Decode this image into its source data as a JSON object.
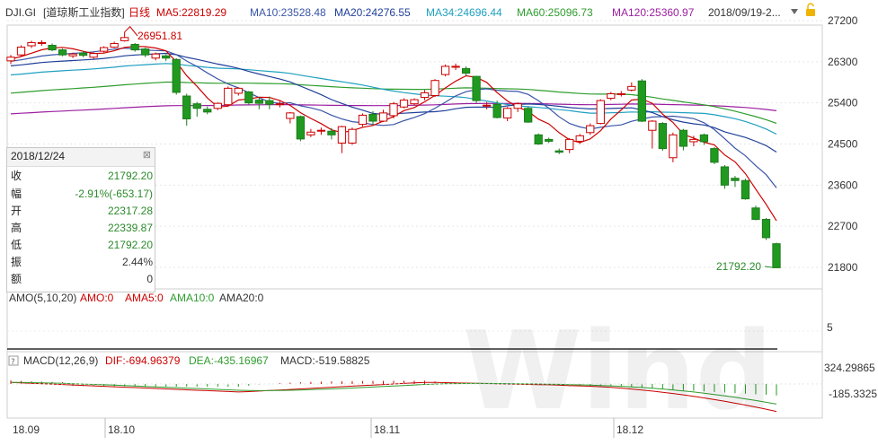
{
  "header": {
    "symbol": "DJI.GI",
    "name": "[道琼斯工业指数]",
    "period": "日线",
    "ma5": "MA5:22819.29",
    "ma10": "MA10:23528.48",
    "ma20": "MA20:24276.55",
    "ma34": "MA34:24696.44",
    "ma60": "MA60:25096.73",
    "ma120": "MA120:25360.97",
    "date_range": "2018/09/19-2...",
    "colors": {
      "ma5": "#cc0000",
      "ma10": "#3a55a8",
      "ma20": "#1f3f99",
      "ma34": "#1fa0c0",
      "ma60": "#2e9d2e",
      "ma120": "#9b1fa0"
    }
  },
  "info_panel": {
    "date": "2018/12/24",
    "close_label": "收",
    "close": "21792.20",
    "change_label": "幅",
    "change": "-2.91%(-653.17)",
    "open_label": "开",
    "open": "22317.28",
    "high_label": "高",
    "high": "22339.87",
    "low_label": "低",
    "low": "21792.20",
    "amplitude_label": "振",
    "amplitude": "2.44%",
    "amount_label": "额",
    "amount": "0"
  },
  "annotations": {
    "high_marker": "26951.81",
    "low_marker": "21792.20"
  },
  "amo_panel": {
    "title": "AMO(5,10,20)",
    "amo": "AMO:0",
    "ama5": "AMA5:0",
    "ama10": "AMA10:0",
    "ama20": "AMA20:0",
    "tick": "5"
  },
  "macd_panel": {
    "title": "MACD(12,26,9)",
    "dif": "DIF:-694.96379",
    "dea": "DEA:-435.16967",
    "macd": "MACD:-519.58825",
    "ticks": [
      "324.29865",
      "-185.3325"
    ]
  },
  "watermark": "Wind",
  "chart_data": {
    "type": "candlestick",
    "y_ticks": [
      "27200",
      "26300",
      "25400",
      "24500",
      "23600",
      "22700",
      "21800"
    ],
    "ylim": [
      21600,
      27300
    ],
    "x_labels": [
      "18.09",
      "18.10",
      "18.11",
      "18.12"
    ],
    "candles": [
      {
        "o": 26320,
        "c": 26400,
        "h": 26450,
        "l": 26250
      },
      {
        "o": 26450,
        "c": 26620,
        "h": 26660,
        "l": 26420
      },
      {
        "o": 26650,
        "c": 26720,
        "h": 26760,
        "l": 26600
      },
      {
        "o": 26700,
        "c": 26720,
        "h": 26770,
        "l": 26650
      },
      {
        "o": 26660,
        "c": 26560,
        "h": 26700,
        "l": 26530
      },
      {
        "o": 26560,
        "c": 26450,
        "h": 26590,
        "l": 26420
      },
      {
        "o": 26430,
        "c": 26470,
        "h": 26500,
        "l": 26380
      },
      {
        "o": 26490,
        "c": 26440,
        "h": 26540,
        "l": 26400
      },
      {
        "o": 26400,
        "c": 26480,
        "h": 26520,
        "l": 26360
      },
      {
        "o": 26530,
        "c": 26610,
        "h": 26640,
        "l": 26500
      },
      {
        "o": 26620,
        "c": 26700,
        "h": 26740,
        "l": 26600
      },
      {
        "o": 26760,
        "c": 26830,
        "h": 26951,
        "l": 26740
      },
      {
        "o": 26680,
        "c": 26560,
        "h": 26710,
        "l": 26520
      },
      {
        "o": 26580,
        "c": 26450,
        "h": 26610,
        "l": 26400
      },
      {
        "o": 26380,
        "c": 26470,
        "h": 26500,
        "l": 26330
      },
      {
        "o": 26430,
        "c": 26380,
        "h": 26460,
        "l": 26320
      },
      {
        "o": 26350,
        "c": 25630,
        "h": 26380,
        "l": 25580
      },
      {
        "o": 25550,
        "c": 25050,
        "h": 25600,
        "l": 24900
      },
      {
        "o": 25380,
        "c": 25280,
        "h": 25420,
        "l": 25100
      },
      {
        "o": 25260,
        "c": 25200,
        "h": 25320,
        "l": 25150
      },
      {
        "o": 25280,
        "c": 25390,
        "h": 25410,
        "l": 25240
      },
      {
        "o": 25360,
        "c": 25720,
        "h": 25760,
        "l": 25340
      },
      {
        "o": 25610,
        "c": 25720,
        "h": 25740,
        "l": 25560
      },
      {
        "o": 25640,
        "c": 25400,
        "h": 25660,
        "l": 25360
      },
      {
        "o": 25460,
        "c": 25390,
        "h": 25520,
        "l": 25260
      },
      {
        "o": 25450,
        "c": 25370,
        "h": 25540,
        "l": 25260
      },
      {
        "o": 25380,
        "c": 25380,
        "h": 25450,
        "l": 25300
      },
      {
        "o": 25060,
        "c": 25180,
        "h": 25200,
        "l": 24950
      },
      {
        "o": 25100,
        "c": 24610,
        "h": 25120,
        "l": 24560
      },
      {
        "o": 24700,
        "c": 24760,
        "h": 24830,
        "l": 24650
      },
      {
        "o": 24800,
        "c": 24800,
        "h": 24860,
        "l": 24700
      },
      {
        "o": 24780,
        "c": 24700,
        "h": 24850,
        "l": 24600
      },
      {
        "o": 24520,
        "c": 24880,
        "h": 24900,
        "l": 24300
      },
      {
        "o": 24520,
        "c": 24820,
        "h": 24860,
        "l": 24480
      },
      {
        "o": 24930,
        "c": 25130,
        "h": 25170,
        "l": 24880
      },
      {
        "o": 25150,
        "c": 25000,
        "h": 25220,
        "l": 24920
      },
      {
        "o": 25000,
        "c": 25180,
        "h": 25250,
        "l": 24980
      },
      {
        "o": 25120,
        "c": 25380,
        "h": 25420,
        "l": 25060
      },
      {
        "o": 25310,
        "c": 25460,
        "h": 25500,
        "l": 25280
      },
      {
        "o": 25380,
        "c": 25470,
        "h": 25500,
        "l": 25340
      },
      {
        "o": 25520,
        "c": 25620,
        "h": 25680,
        "l": 25460
      },
      {
        "o": 25560,
        "c": 25890,
        "h": 25920,
        "l": 25530
      },
      {
        "o": 26020,
        "c": 26200,
        "h": 26240,
        "l": 25980
      },
      {
        "o": 26180,
        "c": 26200,
        "h": 26260,
        "l": 26120
      },
      {
        "o": 26150,
        "c": 26050,
        "h": 26200,
        "l": 25990
      },
      {
        "o": 25980,
        "c": 25450,
        "h": 25990,
        "l": 25400
      },
      {
        "o": 25350,
        "c": 25350,
        "h": 25420,
        "l": 25260
      },
      {
        "o": 25370,
        "c": 25080,
        "h": 25450,
        "l": 25060
      },
      {
        "o": 25070,
        "c": 25280,
        "h": 25310,
        "l": 25000
      },
      {
        "o": 25280,
        "c": 25380,
        "h": 25410,
        "l": 25200
      },
      {
        "o": 25280,
        "c": 24980,
        "h": 25320,
        "l": 24960
      },
      {
        "o": 24700,
        "c": 24500,
        "h": 24730,
        "l": 24480
      },
      {
        "o": 24600,
        "c": 24560,
        "h": 24640,
        "l": 24520
      },
      {
        "o": 24350,
        "c": 24320,
        "h": 24400,
        "l": 24280
      },
      {
        "o": 24380,
        "c": 24600,
        "h": 24630,
        "l": 24300
      },
      {
        "o": 24560,
        "c": 24680,
        "h": 24720,
        "l": 24500
      },
      {
        "o": 24750,
        "c": 24900,
        "h": 24950,
        "l": 24700
      },
      {
        "o": 24950,
        "c": 25450,
        "h": 25480,
        "l": 24930
      },
      {
        "o": 25500,
        "c": 25600,
        "h": 25640,
        "l": 25460
      },
      {
        "o": 25600,
        "c": 25600,
        "h": 25660,
        "l": 25540
      },
      {
        "o": 25680,
        "c": 25760,
        "h": 25850,
        "l": 25650
      },
      {
        "o": 25880,
        "c": 25000,
        "h": 25920,
        "l": 24980
      },
      {
        "o": 24800,
        "c": 25000,
        "h": 25020,
        "l": 24400
      },
      {
        "o": 24950,
        "c": 24400,
        "h": 24980,
        "l": 24350
      },
      {
        "o": 24200,
        "c": 24700,
        "h": 24750,
        "l": 24100
      },
      {
        "o": 24800,
        "c": 24450,
        "h": 24830,
        "l": 24360
      },
      {
        "o": 24550,
        "c": 24600,
        "h": 24680,
        "l": 24450
      },
      {
        "o": 24700,
        "c": 24550,
        "h": 24730,
        "l": 24480
      },
      {
        "o": 24400,
        "c": 24100,
        "h": 24430,
        "l": 24060
      },
      {
        "o": 24000,
        "c": 23600,
        "h": 24040,
        "l": 23520
      },
      {
        "o": 23750,
        "c": 23700,
        "h": 23800,
        "l": 23560
      },
      {
        "o": 23700,
        "c": 23300,
        "h": 23740,
        "l": 23280
      },
      {
        "o": 23100,
        "c": 22850,
        "h": 23150,
        "l": 22830
      },
      {
        "o": 22850,
        "c": 22450,
        "h": 22880,
        "l": 22400
      },
      {
        "o": 22317,
        "c": 21792,
        "h": 22340,
        "l": 21792
      }
    ]
  }
}
